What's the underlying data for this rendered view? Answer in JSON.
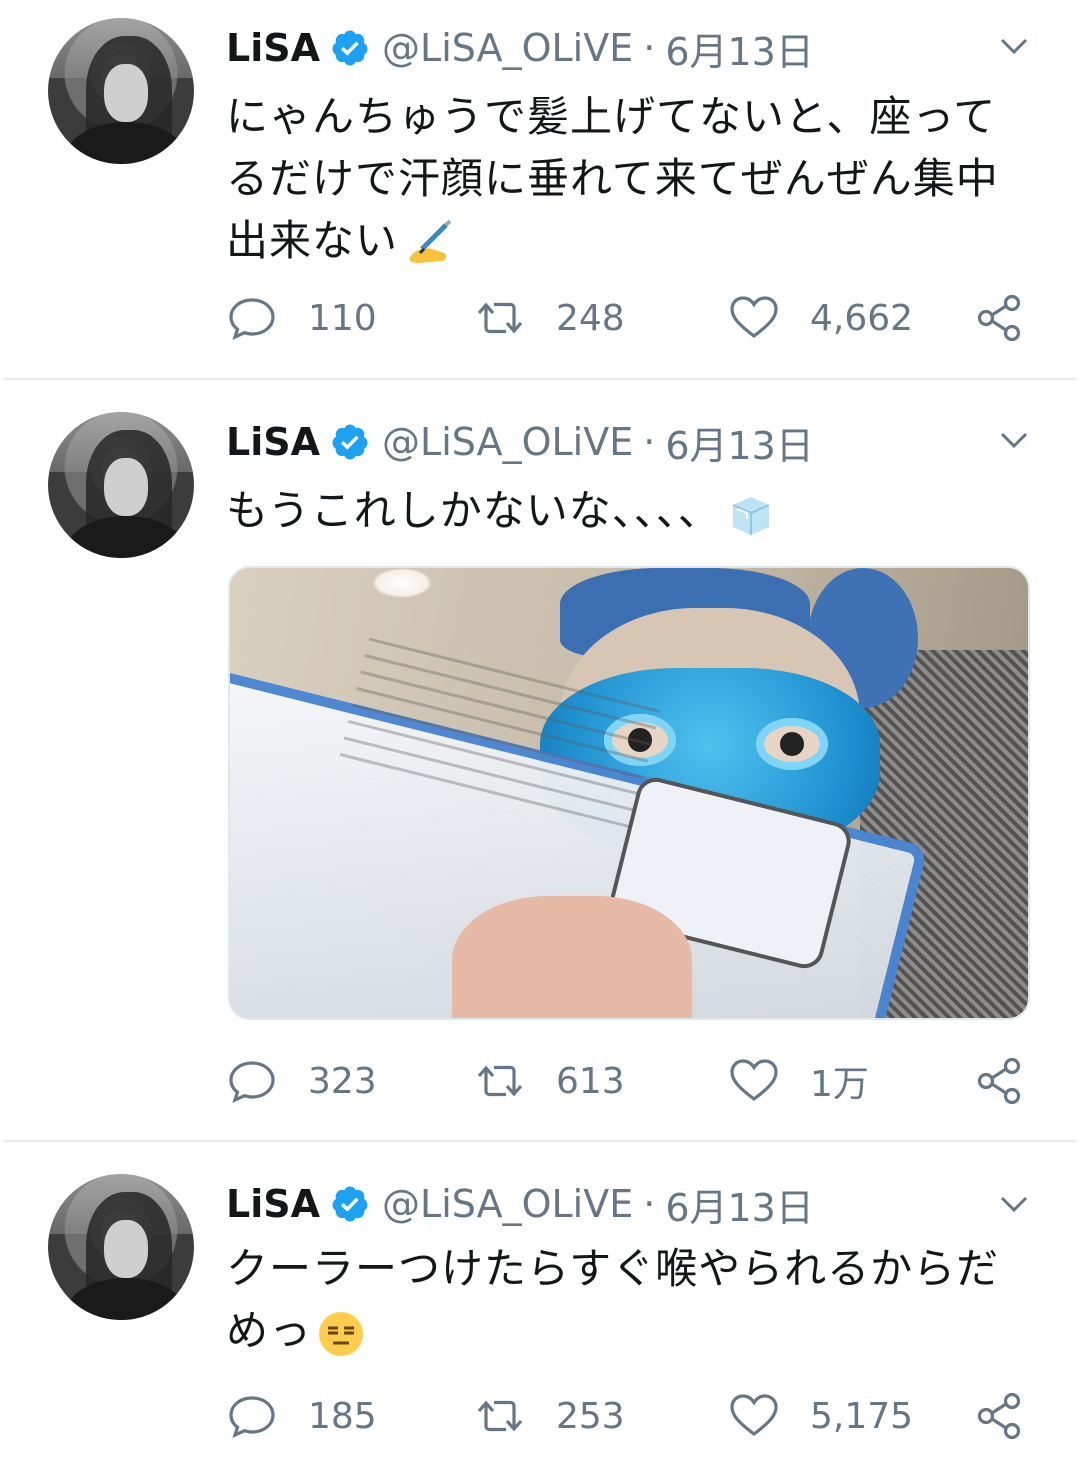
{
  "tweets": [
    {
      "name": "LiSA",
      "handle": "@LiSA_OLiVE",
      "separator": "·",
      "date": "6月13日",
      "text": "にゃんちゅうで髪上げてないと、座ってるだけで汗顔に垂れて来てぜんぜん集中出来ない",
      "emoji": "writing-hand-emoji",
      "reply_count": "110",
      "retweet_count": "248",
      "like_count": "4,662"
    },
    {
      "name": "LiSA",
      "handle": "@LiSA_OLiVE",
      "separator": "·",
      "date": "6月13日",
      "text": "もうこれしかないな、、、、",
      "emoji": "ice-cube-emoji",
      "has_media": true,
      "reply_count": "323",
      "retweet_count": "613",
      "like_count": "1万"
    },
    {
      "name": "LiSA",
      "handle": "@LiSA_OLiVE",
      "separator": "·",
      "date": "6月13日",
      "text": "クーラーつけたらすぐ喉やられるからだめっ",
      "emoji": "expressionless-face-emoji",
      "reply_count": "185",
      "retweet_count": "253",
      "like_count": "5,175"
    }
  ],
  "icons": {
    "verified": "verified-badge-icon",
    "caret": "chevron-down-icon",
    "reply": "reply-icon",
    "retweet": "retweet-icon",
    "like": "heart-icon",
    "share": "share-icon"
  },
  "colors": {
    "verified_blue": "#1da1f2",
    "secondary_text": "#657786",
    "divider": "#e6ecf0"
  }
}
